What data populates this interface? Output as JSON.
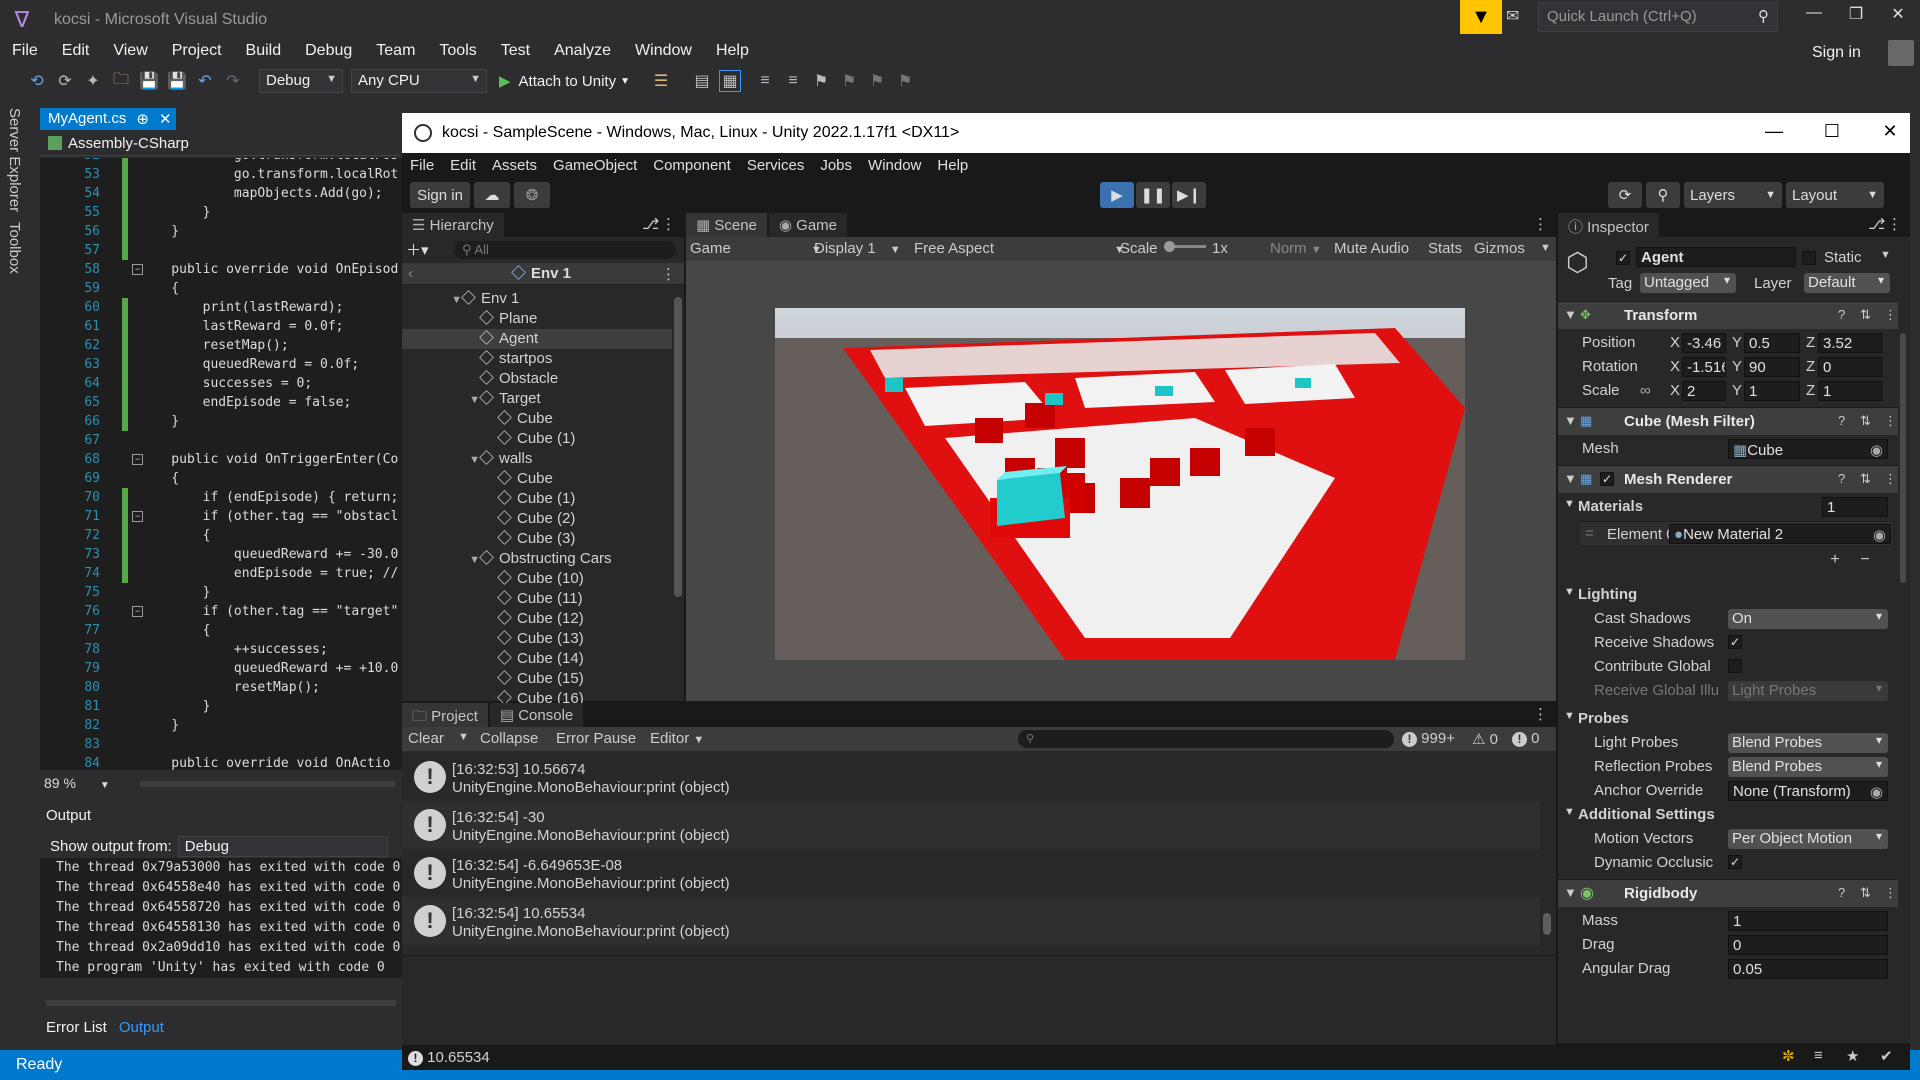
{
  "vs": {
    "title": "kocsi - Microsoft Visual Studio",
    "quick_launch": "Quick Launch (Ctrl+Q)",
    "menu": [
      "File",
      "Edit",
      "View",
      "Project",
      "Build",
      "Debug",
      "Team",
      "Tools",
      "Test",
      "Analyze",
      "Window",
      "Help"
    ],
    "sign_in": "Sign in",
    "config": "Debug",
    "platform": "Any CPU",
    "attach": "Attach to Unity",
    "side_tabs": [
      "Server Explorer",
      "Toolbox"
    ],
    "doc_tab": "MyAgent.cs",
    "doc_tab_pin": "⊕",
    "project": "Assembly-CSharp",
    "zoom": "89 %",
    "output_title": "Output",
    "output_from_label": "Show output from:",
    "output_from": "Debug",
    "output_lines": [
      "The thread 0x79a53000 has exited with code 0",
      "The thread 0x64558e40 has exited with code 0",
      "The thread 0x64558720 has exited with code 0",
      "The thread 0x64558130 has exited with code 0",
      "The thread 0x2a09dd10 has exited with code 0",
      "The program 'Unity' has exited with code 0"
    ],
    "bottom_tabs": [
      "Error List",
      "Output"
    ],
    "status": "Ready",
    "line_numbers": [
      "52",
      "53",
      "54",
      "55",
      "56",
      "57",
      "58",
      "59",
      "60",
      "61",
      "62",
      "63",
      "64",
      "65",
      "66",
      "67",
      "68",
      "69",
      "70",
      "71",
      "72",
      "73",
      "74",
      "75",
      "76",
      "77",
      "78",
      "79",
      "80",
      "81",
      "82",
      "83",
      "84"
    ],
    "code_lines": [
      "            go.transform.localPos",
      "            go.transform.localRot",
      "            mapObjects.Add(go);",
      "        }",
      "    }",
      "",
      "    public override void OnEpisod",
      "    {",
      "        print(lastReward);",
      "        lastReward = 0.0f;",
      "        resetMap();",
      "        queuedReward = 0.0f;",
      "        successes = 0;",
      "        endEpisode = false;",
      "    }",
      "",
      "    public void OnTriggerEnter(Co",
      "    {",
      "        if (endEpisode) { return;",
      "        if (other.tag == \"obstacl",
      "        {",
      "            queuedReward += -30.0",
      "            endEpisode = true; //",
      "        }",
      "        if (other.tag == \"target\"",
      "        {",
      "            ++successes;",
      "            queuedReward += +10.0",
      "            resetMap();",
      "        }",
      "    }",
      "",
      "    public override void OnActio"
    ]
  },
  "unity": {
    "title": "kocsi - SampleScene - Windows, Mac, Linux - Unity 2022.1.17f1 <DX11>",
    "menu": [
      "File",
      "Edit",
      "Assets",
      "GameObject",
      "Component",
      "Services",
      "Jobs",
      "Window",
      "Help"
    ],
    "sign_in": "Sign in",
    "layers": "Layers",
    "layout": "Layout",
    "hierarchy": {
      "tab": "Hierarchy",
      "search_placeholder": "All",
      "scene": "Env 1",
      "items": [
        {
          "label": "Env 1",
          "depth": 0,
          "expanded": true
        },
        {
          "label": "Plane",
          "depth": 1
        },
        {
          "label": "Agent",
          "depth": 1,
          "selected": true
        },
        {
          "label": "startpos",
          "depth": 1
        },
        {
          "label": "Obstacle",
          "depth": 1
        },
        {
          "label": "Target",
          "depth": 1,
          "expanded": true
        },
        {
          "label": "Cube",
          "depth": 2
        },
        {
          "label": "Cube (1)",
          "depth": 2
        },
        {
          "label": "walls",
          "depth": 1,
          "expanded": true
        },
        {
          "label": "Cube",
          "depth": 2
        },
        {
          "label": "Cube (1)",
          "depth": 2
        },
        {
          "label": "Cube (2)",
          "depth": 2
        },
        {
          "label": "Cube (3)",
          "depth": 2
        },
        {
          "label": "Obstructing Cars",
          "depth": 1,
          "expanded": true
        },
        {
          "label": "Cube (10)",
          "depth": 2
        },
        {
          "label": "Cube (11)",
          "depth": 2
        },
        {
          "label": "Cube (12)",
          "depth": 2
        },
        {
          "label": "Cube (13)",
          "depth": 2
        },
        {
          "label": "Cube (14)",
          "depth": 2
        },
        {
          "label": "Cube (15)",
          "depth": 2
        },
        {
          "label": "Cube (16)",
          "depth": 2
        }
      ]
    },
    "game": {
      "tabs": [
        "Scene",
        "Game"
      ],
      "mode": "Game",
      "display": "Display 1",
      "aspect": "Free Aspect",
      "scale_label": "Scale",
      "scale_value": "1x",
      "norm": "Norm",
      "mute": "Mute Audio",
      "stats": "Stats",
      "gizmos": "Gizmos"
    },
    "console": {
      "tabs": [
        "Project",
        "Console"
      ],
      "clear": "Clear",
      "collapse": "Collapse",
      "error_pause": "Error Pause",
      "editor": "Editor",
      "count_log": "999+",
      "count_warn": "0",
      "count_err": "0",
      "entries": [
        {
          "line1": "[16:32:53] 10.56674",
          "line2": "UnityEngine.MonoBehaviour:print (object)"
        },
        {
          "line1": "[16:32:54] -30",
          "line2": "UnityEngine.MonoBehaviour:print (object)"
        },
        {
          "line1": "[16:32:54] -6.649653E-08",
          "line2": "UnityEngine.MonoBehaviour:print (object)"
        },
        {
          "line1": "[16:32:54] 10.65534",
          "line2": "UnityEngine.MonoBehaviour:print (object)"
        }
      ],
      "status_line": "10.65534"
    },
    "inspector": {
      "tab": "Inspector",
      "name": "Agent",
      "static": "Static",
      "tag_label": "Tag",
      "tag": "Untagged",
      "layer_label": "Layer",
      "layer": "Default",
      "transform": {
        "title": "Transform",
        "position_label": "Position",
        "rotation_label": "Rotation",
        "scale_label": "Scale",
        "x": "X",
        "y": "Y",
        "z": "Z",
        "position": [
          "-3.46",
          "0.5",
          "3.52"
        ],
        "rotation": [
          "-1.516",
          "90",
          "0"
        ],
        "scale": [
          "2",
          "1",
          "1"
        ]
      },
      "mesh_filter": {
        "title": "Cube (Mesh Filter)",
        "mesh_label": "Mesh",
        "mesh": "Cube"
      },
      "mesh_renderer": {
        "title": "Mesh Renderer",
        "materials_label": "Materials",
        "materials_count": "1",
        "element_label": "Element 0",
        "element": "New Material 2",
        "lighting": "Lighting",
        "cast_shadows_label": "Cast Shadows",
        "cast_shadows": "On",
        "receive_shadows_label": "Receive Shadows",
        "contribute_gi_label": "Contribute Global",
        "receive_gi_label": "Receive Global Illu",
        "receive_gi": "Light Probes",
        "probes": "Probes",
        "light_probes_label": "Light Probes",
        "light_probes": "Blend Probes",
        "reflection_probes_label": "Reflection Probes",
        "reflection_probes": "Blend Probes",
        "anchor_label": "Anchor Override",
        "anchor": "None (Transform)",
        "additional": "Additional Settings",
        "motion_label": "Motion Vectors",
        "motion": "Per Object Motion",
        "dynamic_label": "Dynamic Occlusic"
      },
      "rigidbody": {
        "title": "Rigidbody",
        "mass_label": "Mass",
        "mass": "1",
        "drag_label": "Drag",
        "drag": "0",
        "angular_label": "Angular Drag",
        "angular": "0.05"
      }
    }
  }
}
